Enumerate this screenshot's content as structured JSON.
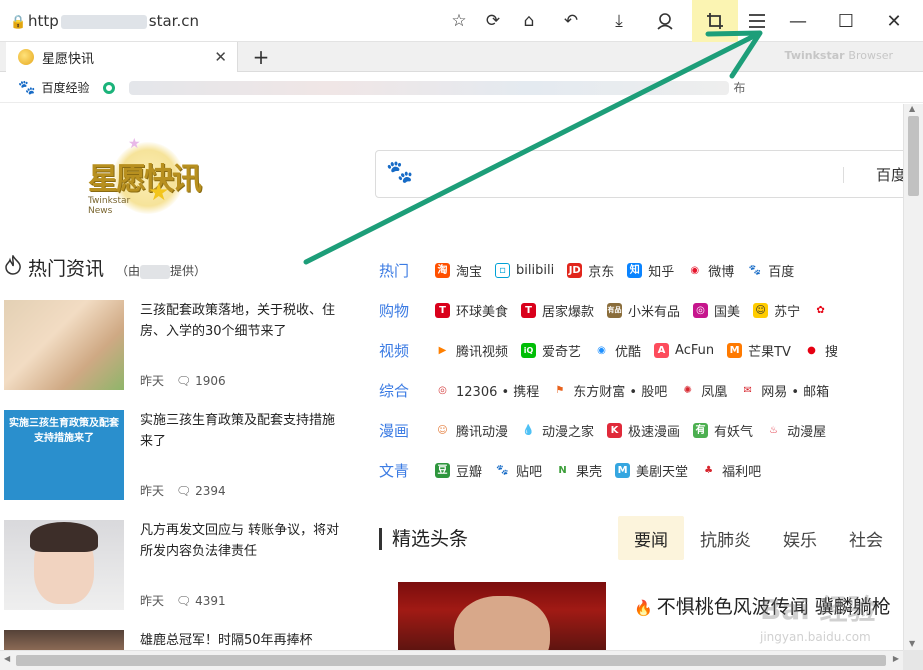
{
  "browser": {
    "url_prefix": "http",
    "url_suffix": "star.cn",
    "tab_title": "星愿快讯",
    "brand_name": "Twinkstar",
    "brand_suffix": "Browser",
    "toolbar_icons": [
      "star-icon",
      "refresh-icon",
      "home-icon",
      "undo-icon",
      "download-icon",
      "user-icon",
      "crop-icon",
      "menu-icon"
    ],
    "accent_highlight": "#fbf4b2"
  },
  "bookmarks": {
    "first_label": "百度经验",
    "tail_label": "布"
  },
  "logo": {
    "cn_text": "星愿快讯",
    "en_line1": "Twinkstar",
    "en_line2": "News"
  },
  "search": {
    "engine_label": "百度",
    "placeholder": ""
  },
  "hot_news": {
    "title": "热门资讯",
    "by_prefix": "（由",
    "by_suffix": "提供）",
    "items": [
      {
        "title": "三孩配套政策落地，关于税收、住房、入学的30个细节来了",
        "time": "昨天",
        "comments": "1906"
      },
      {
        "title": "实施三孩生育政策及配套支持措施来了",
        "time": "昨天",
        "comments": "2394",
        "thumb_text": "实施三孩生育政策及配套支持措施来了"
      },
      {
        "title": "凡方再发文回应与 转账争议，将对所发内容负法律责任",
        "time": "昨天",
        "comments": "4391"
      },
      {
        "title": "雄鹿总冠军！时隔50年再捧杯",
        "time": "",
        "comments": ""
      }
    ]
  },
  "categories": [
    {
      "label": "热门",
      "sites": [
        "淘宝",
        "bilibili",
        "京东",
        "知乎",
        "微博",
        "百度"
      ]
    },
    {
      "label": "购物",
      "sites": [
        "环球美食",
        "居家爆款",
        "小米有品",
        "国美",
        "苏宁",
        ""
      ]
    },
    {
      "label": "视频",
      "sites": [
        "腾讯视频",
        "爱奇艺",
        "优酷",
        "AcFun",
        "芒果TV",
        "搜"
      ]
    },
    {
      "label": "综合",
      "sites": [
        "12306 • 携程",
        "东方财富 • 股吧",
        "凤凰",
        "网易 • 邮箱"
      ]
    },
    {
      "label": "漫画",
      "sites": [
        "腾讯动漫",
        "动漫之家",
        "极速漫画",
        "有妖气",
        "动漫屋"
      ]
    },
    {
      "label": "文青",
      "sites": [
        "豆瓣",
        "贴吧",
        "果壳",
        "美剧天堂",
        "福利吧"
      ]
    }
  ],
  "featured": {
    "title": "精选头条",
    "tabs": [
      "要闻",
      "抗肺炎",
      "娱乐",
      "社会"
    ],
    "active_tab": "要闻",
    "headline": "不惧桃色风波传闻 骥麟躺枪"
  },
  "watermark": {
    "text": "Bai 经验",
    "url": "jingyan.baidu.com"
  },
  "colors": {
    "link_blue": "#3b7be3",
    "annotation_arrow": "#1d9e79"
  }
}
